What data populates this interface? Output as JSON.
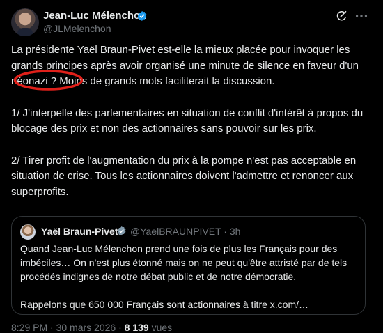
{
  "author": {
    "name": "Jean-Luc Mélenchon",
    "handle": "@JLMelenchon"
  },
  "icons": {
    "verified": "verified-badge-icon",
    "grok": "grok-icon",
    "more": "more-icon",
    "accent": "#1d9bf0",
    "annotation": "#e0201a"
  },
  "tweet": {
    "paragraphs": [
      "La présidente Yaël Braun-Pivet est-elle la mieux placée pour invoquer les grands principes après avoir organisé une minute de silence en faveur d'un néonazi ? Moins de grands mots faciliterait la discussion.",
      "1/ J'interpelle des parlementaires en situation de conflit d'intérêt à propos du blocage des prix et non des actionnaires sans pouvoir sur les prix.",
      "2/ Tirer profit de l'augmentation du prix à la pompe n'est pas acceptable en situation de crise. Tous les actionnaires doivent l'admettre et renoncer aux superprofits."
    ]
  },
  "quote": {
    "name": "Yaël Braun-Pivet",
    "handle_time": "@YaelBRAUNPIVET · 3h",
    "paragraphs": [
      "Quand Jean-Luc Mélenchon prend une fois de plus les Français pour des imbéciles… On n'est plus étonné mais on ne peut qu'être attristé par de tels procédés indignes de notre débat public et de notre démocratie.",
      "Rappelons que 650 000 Français sont actionnaires à titre x.com/…"
    ]
  },
  "meta": {
    "time_date": "8:29 PM · 30 mars 2026 · ",
    "views_count": "8 139",
    "views_label": " vues"
  }
}
